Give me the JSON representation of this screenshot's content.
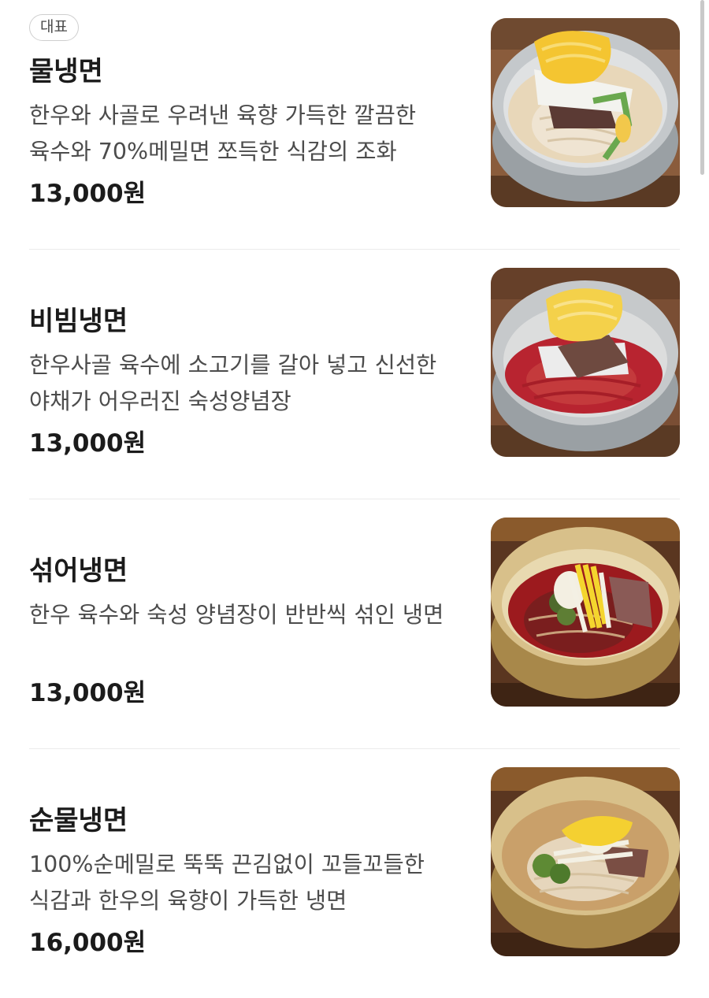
{
  "menu": {
    "items": [
      {
        "badge": "대표",
        "name": "물냉면",
        "description": "한우와 사골로 우려낸 육향 가득한 깔끔한 육수와 70%메밀면 쪼득한 식감의 조화",
        "price": "13,000원",
        "image_style": "clear-broth",
        "broth_color": "#e8d7b9",
        "noodle_color": "#efe4d2"
      },
      {
        "name": "비빔냉면",
        "description": "한우사골 육수에 소고기를 갈아 넣고 신선한 야채가 어우러진 숙성양념장",
        "price": "13,000원",
        "image_style": "spicy-sauce",
        "broth_color": "#b82430",
        "noodle_color": "#c43a3c"
      },
      {
        "name": "섞어냉면",
        "description": "한우 육수와 숙성 양념장이 반반씩 섞인 냉면",
        "price": "13,000원",
        "image_style": "mixed",
        "broth_color": "#9c1a1e",
        "noodle_color": "#7a1e1e"
      },
      {
        "name": "순물냉면",
        "description": "100%순메밀로 뚝뚝 끈김없이 꼬들꼬들한 식감과 한우의 육향이 가득한 냉면",
        "price": "16,000원",
        "image_style": "clear-broth",
        "broth_color": "#c9a06a",
        "noodle_color": "#e6d6bc"
      }
    ]
  }
}
